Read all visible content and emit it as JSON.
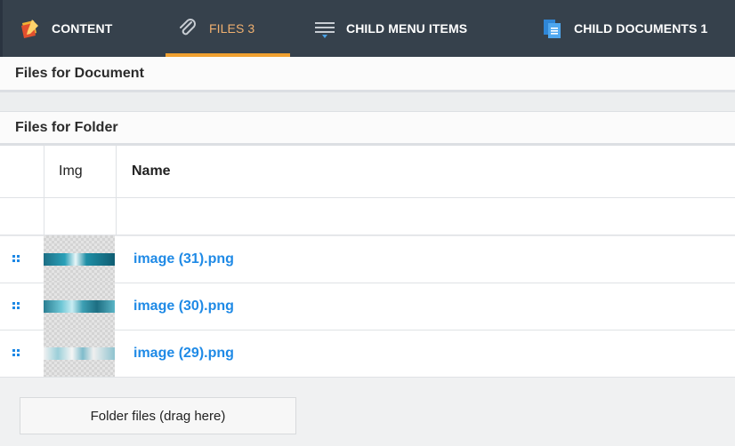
{
  "tabs": [
    {
      "label": "CONTENT",
      "icon": "content-edit-icon"
    },
    {
      "label": "FILES 3",
      "icon": "paperclip-icon"
    },
    {
      "label": "CHILD MENU ITEMS",
      "icon": "menu-list-icon"
    },
    {
      "label": "CHILD DOCUMENTS 1",
      "icon": "documents-icon"
    }
  ],
  "sections": {
    "document_title": "Files for Document",
    "folder_title": "Files for Folder"
  },
  "grid": {
    "columns": {
      "img": "Img",
      "name": "Name"
    },
    "rows": [
      {
        "name": "image (31).png"
      },
      {
        "name": "image (30).png"
      },
      {
        "name": "image (29).png"
      }
    ]
  },
  "footer": {
    "drop_label": "Folder files (drag here)"
  },
  "colors": {
    "tab_bg": "#36414c",
    "active_tab": "#f0a030",
    "link": "#1f8ae6"
  }
}
